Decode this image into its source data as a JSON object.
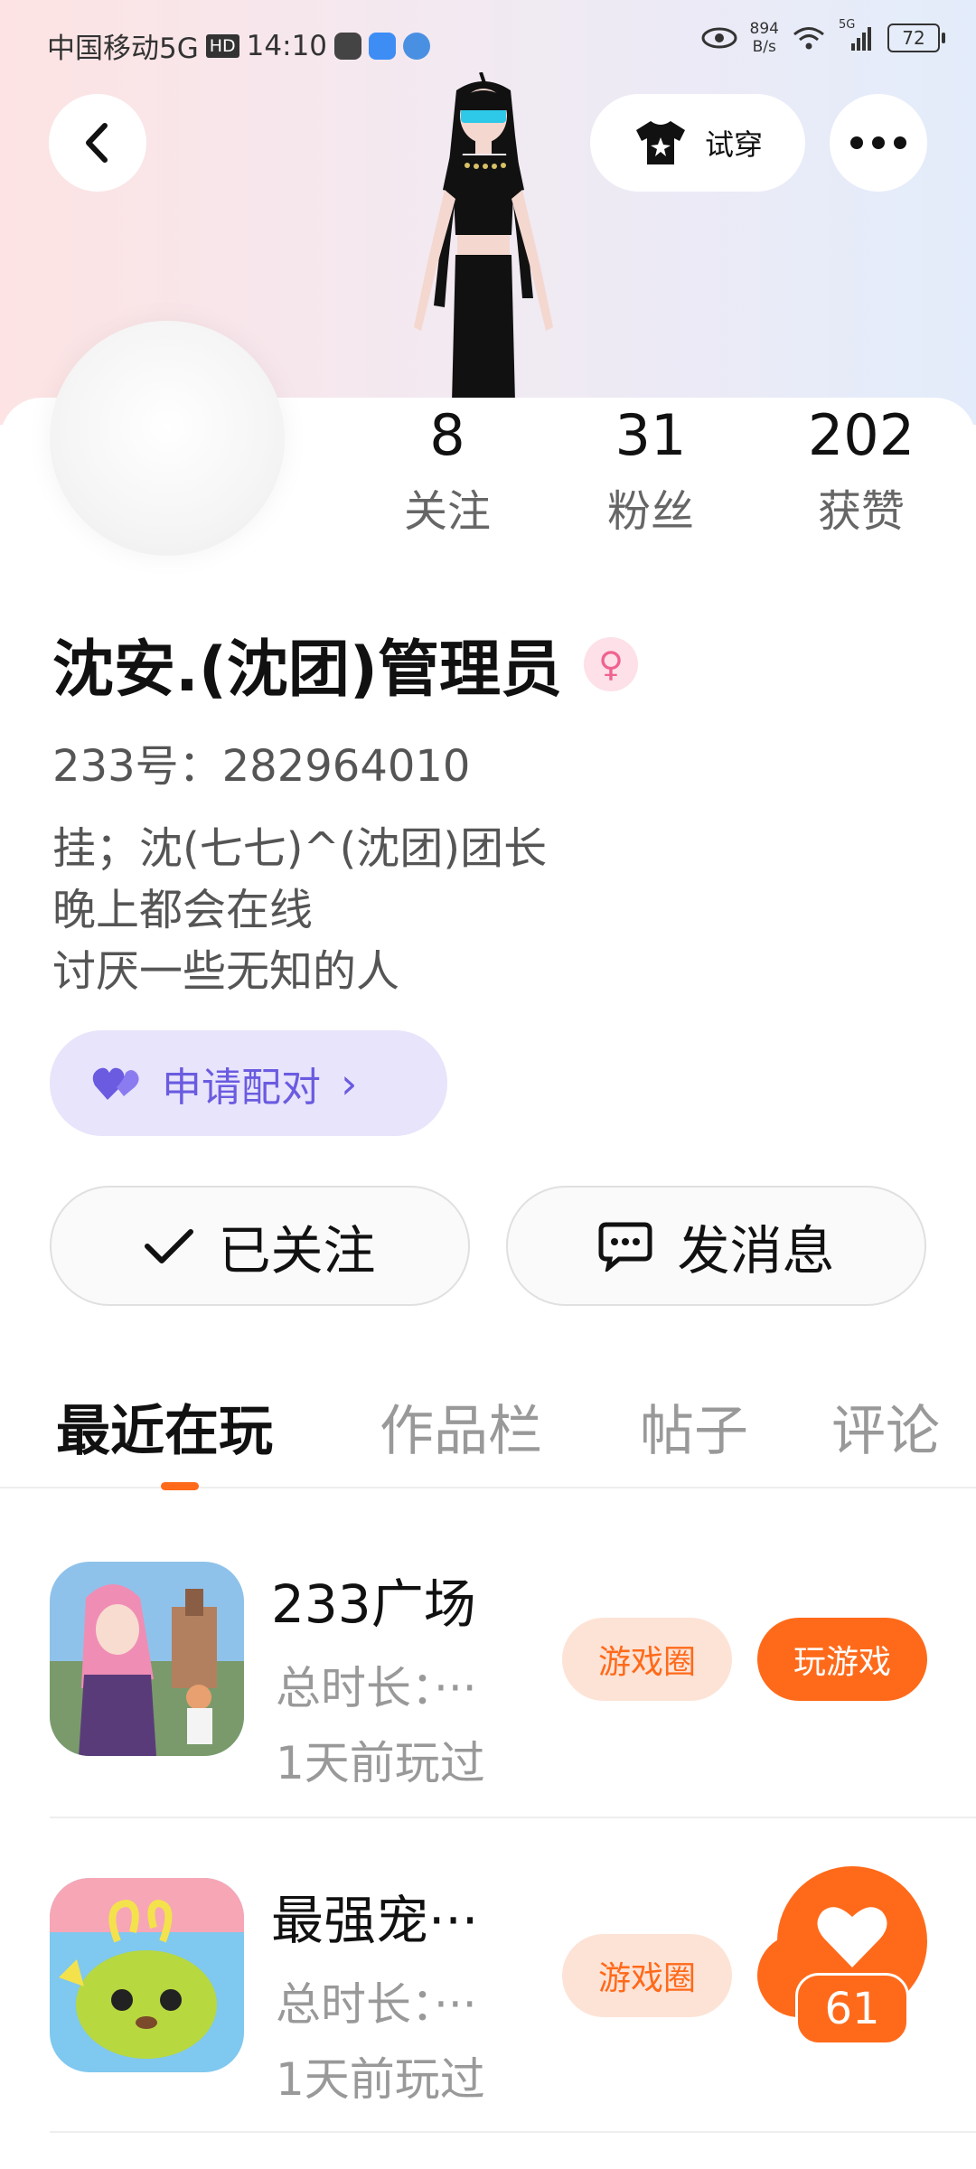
{
  "status_bar": {
    "carrier": "中国移动5G",
    "hd": "HD",
    "time": "14:10",
    "net_speed_value": "894",
    "net_speed_unit": "B/s",
    "signal_label": "5G",
    "battery": "72"
  },
  "header": {
    "tryon_label": "试穿"
  },
  "stats": {
    "following": {
      "value": "8",
      "label": "关注"
    },
    "followers": {
      "value": "31",
      "label": "粉丝"
    },
    "likes": {
      "value": "202",
      "label": "获赞"
    }
  },
  "profile": {
    "name": "沈安.(沈团)管理员",
    "gender_symbol": "♀",
    "uid": "233号：282964010",
    "bio": [
      "挂；沈(七七)^(沈团)团长",
      "晚上都会在线",
      "讨厌一些无知的人"
    ]
  },
  "pair_button": {
    "label": "申请配对",
    "chevron": "›"
  },
  "actions": {
    "follow_label": "已关注",
    "message_label": "发消息"
  },
  "tabs": [
    {
      "label": "最近在玩",
      "active": true
    },
    {
      "label": "作品栏",
      "active": false
    },
    {
      "label": "帖子",
      "active": false
    },
    {
      "label": "评论",
      "active": false
    }
  ],
  "games": [
    {
      "title": "233广场",
      "duration": "总时长：···",
      "last_played": "1天前玩过",
      "circle_label": "游戏圈",
      "play_label": "玩游戏"
    },
    {
      "title": "最强宠···",
      "duration": "总时长：···",
      "last_played": "1天前玩过",
      "circle_label": "游戏圈"
    }
  ],
  "like_widget": {
    "count": "61"
  },
  "colors": {
    "accent": "#ff6a1a",
    "pair_bg": "#e8e4fb",
    "pair_text": "#6a5be0",
    "gender": "#f06292"
  }
}
